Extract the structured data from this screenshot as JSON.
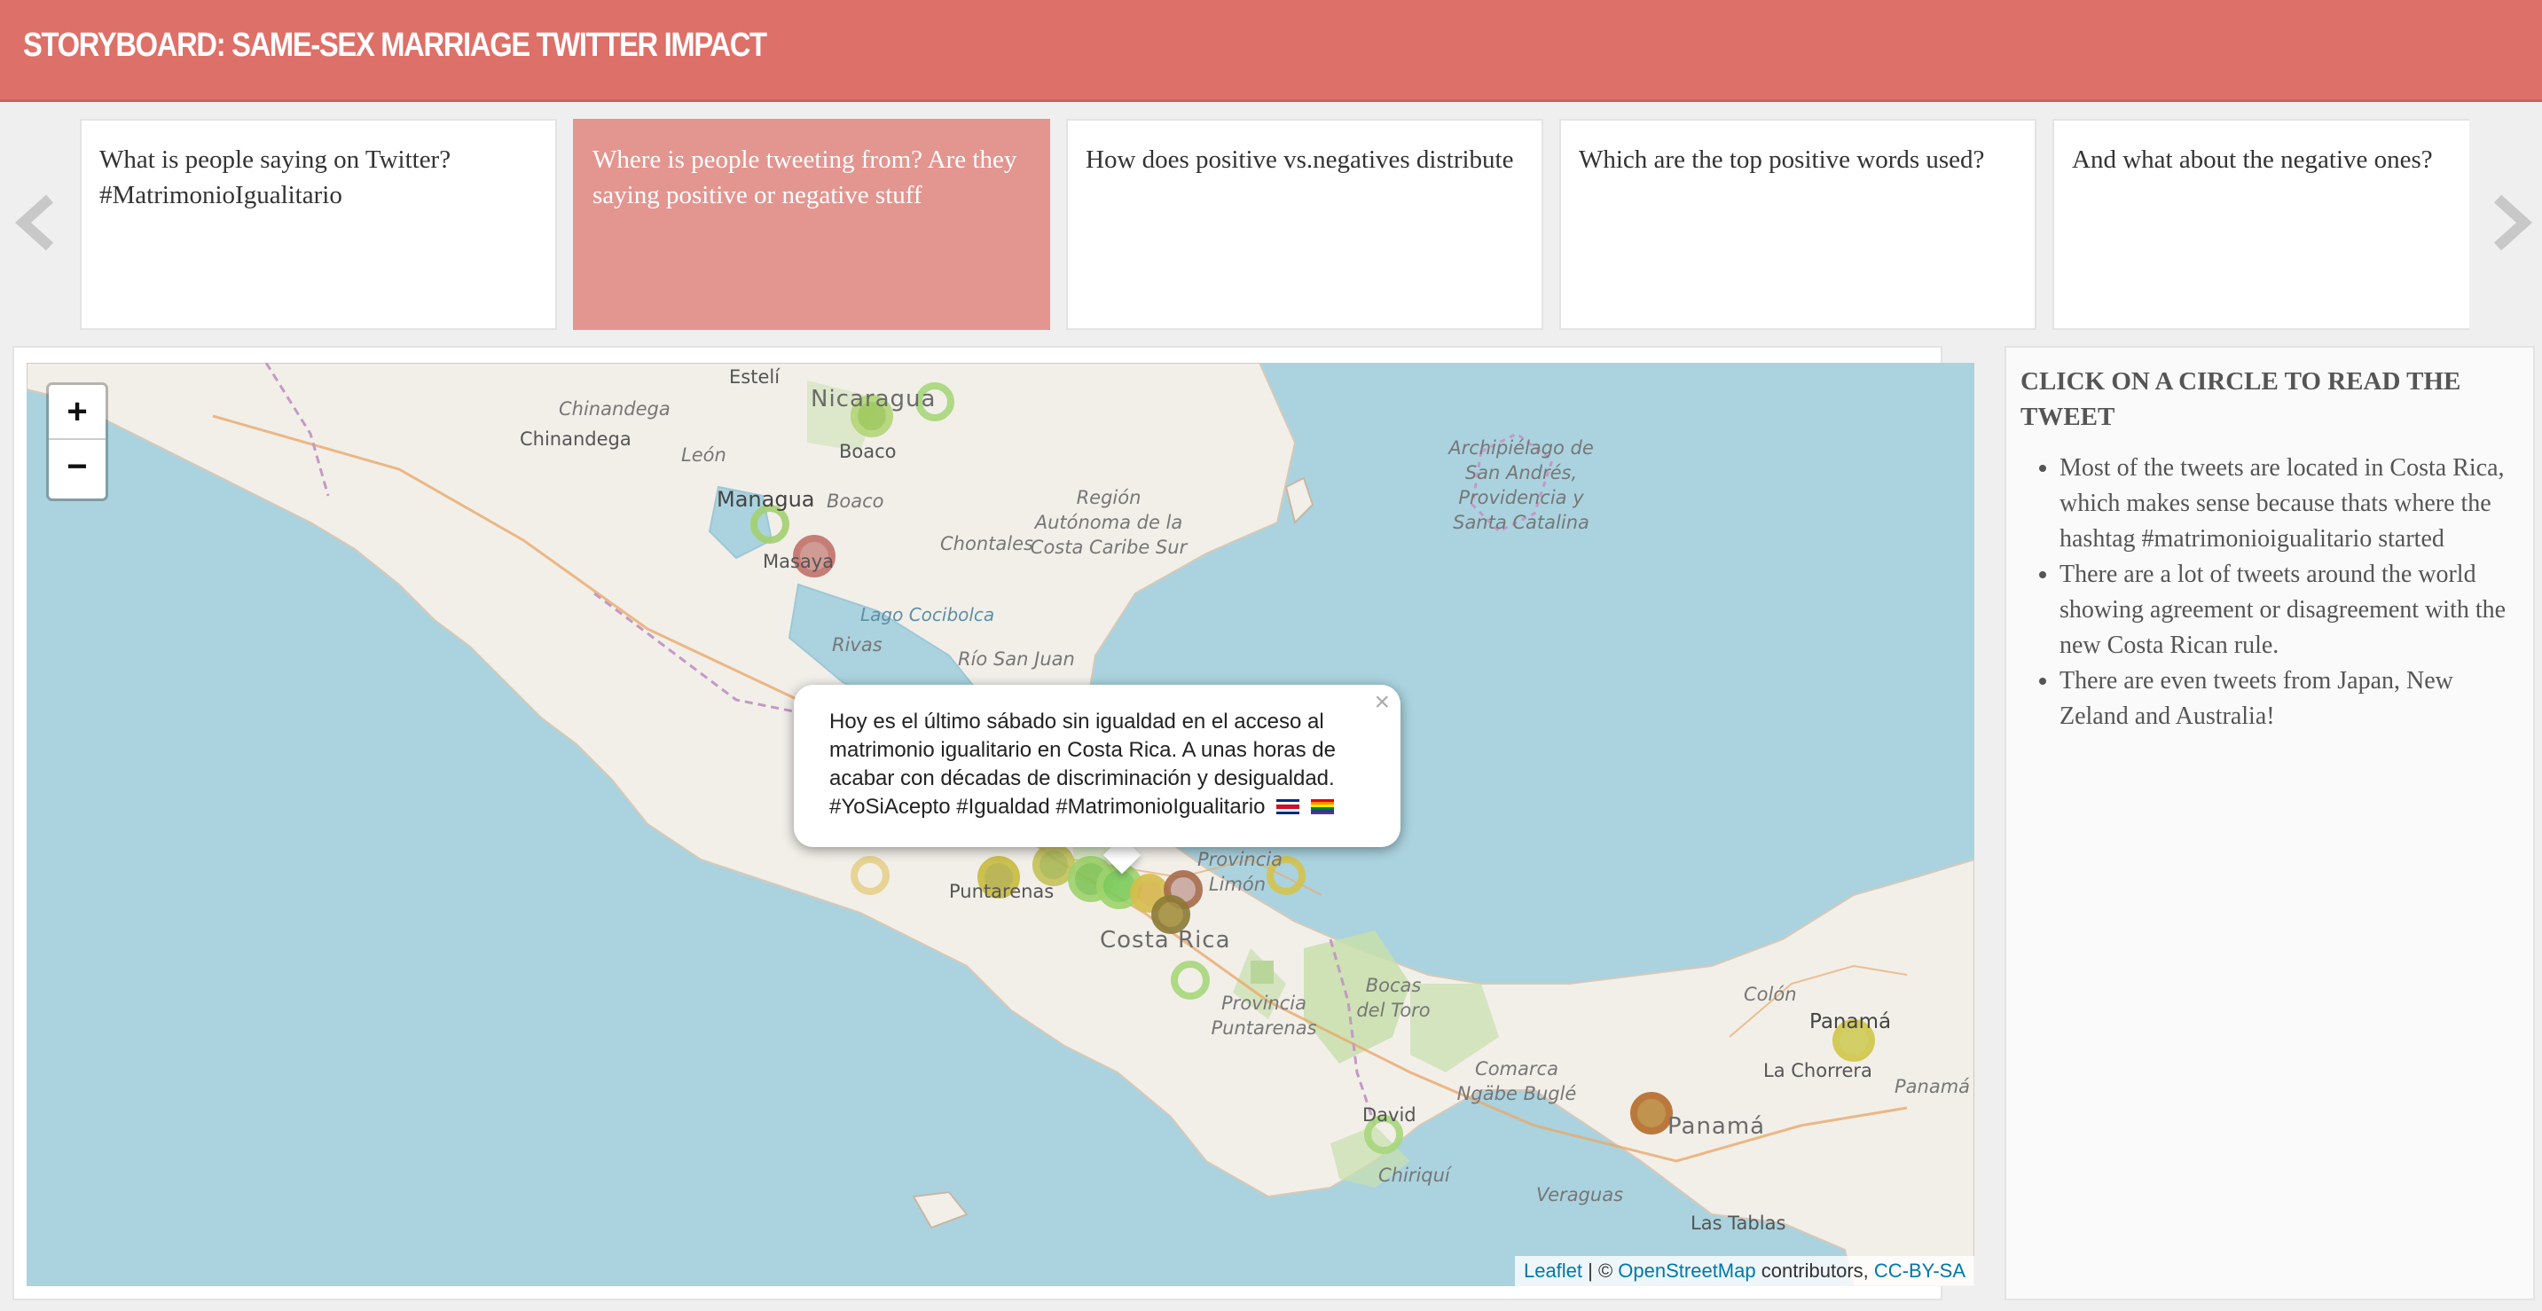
{
  "header": {
    "title": "STORYBOARD: SAME-SEX MARRIAGE TWITTER IMPACT"
  },
  "carousel": {
    "cards": [
      {
        "text": "What is people saying on Twitter? #MatrimonioIgualitario",
        "active": false
      },
      {
        "text": "Where is people tweeting from? Are they saying positive or negative stuff",
        "active": true
      },
      {
        "text": "How does positive vs.negatives distribute",
        "active": false
      },
      {
        "text": "Which are the top positive words used?",
        "active": false
      },
      {
        "text": "And what about the negative ones?",
        "active": false
      }
    ],
    "prev_icon": "chevron-left-icon",
    "next_icon": "chevron-right-icon"
  },
  "map": {
    "zoom_in": "+",
    "zoom_out": "−",
    "labels": {
      "esteli": "Estelí",
      "nicaragua": "Nicaragua",
      "chinandega_dept": "Chinandega",
      "chinandega": "Chinandega",
      "boaco_city": "Boaco",
      "leon": "León",
      "managua": "Managua",
      "boaco_dept": "Boaco",
      "chontales": "Chontales",
      "masaya": "Masaya",
      "raccs": "Región Autónoma de la Costa Caribe Sur",
      "archipielago": "Archipiélago de San Andrés, Providencia y Santa Catalina",
      "lago": "Lago Cocibolca",
      "rivas": "Rivas",
      "rio_san_juan": "Río San Juan",
      "puntarenas": "Puntarenas",
      "limon": "Provincia Limón",
      "costa_rica": "Costa Rica",
      "prov_puntarenas": "Provincia Puntarenas",
      "bocas": "Bocas del Toro",
      "colon": "Colón",
      "panama_city": "Panamá",
      "la_chorrera": "La Chorrera",
      "panama_prov": "Panamá",
      "comarca": "Comarca Ngäbe Buglé",
      "panama_country": "Panamá",
      "david": "David",
      "chiriqui": "Chiriquí",
      "veraguas": "Veraguas",
      "las_tablas": "Las Tablas"
    },
    "popup": {
      "text": "Hoy es el último sábado sin igualdad en el acceso al matrimonio igualitario en Costa Rica. A unas horas de acabar con décadas de discriminación y desigualdad. #YoSiAcepto #Igualdad #MatrimonioIgualitario",
      "close": "×",
      "flags": [
        "costa-rica-flag-icon",
        "rainbow-flag-icon"
      ]
    },
    "attribution": {
      "leaflet": "Leaflet",
      "sep": " | © ",
      "osm": "OpenStreetMap",
      "contrib": " contributors, ",
      "license": "CC-BY-SA"
    },
    "colors": {
      "positive": "#8cc63f",
      "negative": "#b5504a",
      "neutral": "#c8b23a",
      "water": "#aad3df",
      "land": "#f2efe9"
    }
  },
  "side": {
    "title": "CLICK ON A CIRCLE TO READ THE TWEET",
    "bullets": [
      "Most of the tweets are located in Costa Rica, which makes sense because thats where the hashtag #matrimonioigualitario started",
      "There are a lot of tweets around the world showing agreement or disagreement with the new Costa Rican rule.",
      "There are even tweets from Japan, New Zeland and Australia!"
    ]
  }
}
